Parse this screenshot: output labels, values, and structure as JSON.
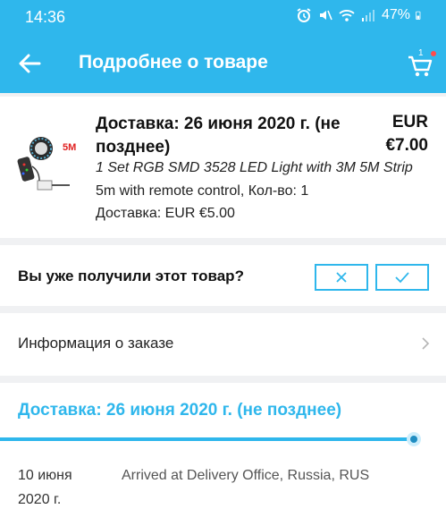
{
  "status_bar": {
    "time": "14:36",
    "battery": "47%"
  },
  "app_bar": {
    "title": "Подробнее о товаре",
    "cart_count": "1"
  },
  "product": {
    "delivery_title": "Доставка: 26 июня 2020 г. (не позднее)",
    "price_currency": "EUR",
    "price": "€7.00",
    "name": "1 Set RGB SMD 3528 LED Light with 3M 5M Strip",
    "variant": "5m with remote control, Кол-во: 1",
    "shipping": "Доставка: EUR €5.00",
    "thumb_badge": "5M"
  },
  "received": {
    "question": "Вы уже получили этот товар?"
  },
  "order_info": {
    "label": "Информация о заказе"
  },
  "tracking": {
    "title": "Доставка: 26 июня 2020 г. (не позднее)",
    "events": [
      {
        "date": "10 июня 2020 г.",
        "text": "Arrived at Delivery Office, Russia, RUS"
      }
    ]
  },
  "colors": {
    "accent": "#2fb7ec",
    "background": "#f0f1f3",
    "card": "#ffffff"
  }
}
